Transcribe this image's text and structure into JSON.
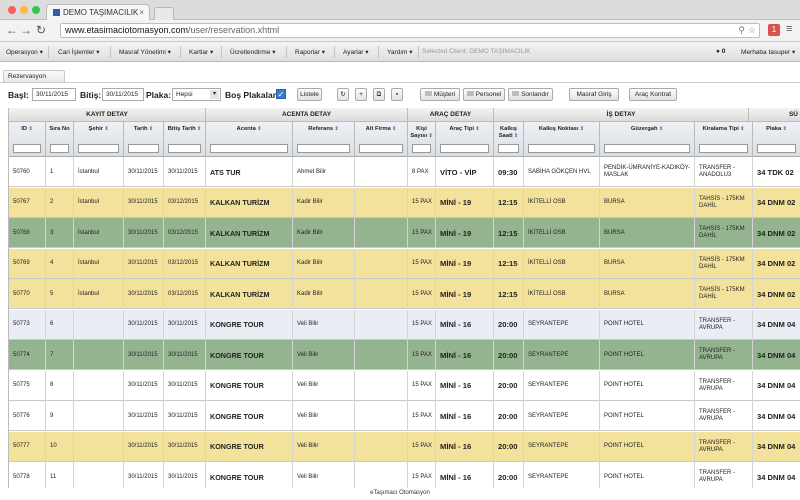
{
  "browser": {
    "tab_title": "DEMO TAŞIMACILIK",
    "url_host": "www.etasimaciotomasyon.com",
    "url_path": "/user/reservation.xhtml",
    "ext_badge": "1"
  },
  "nav": {
    "items": [
      "Operasyon ▾",
      "Cari İşlemler ▾",
      "Masraf Yönetimi ▾",
      "Kartlar ▾",
      "Ücretlendirme ▾",
      "Raporlar ▾",
      "Ayarlar ▾",
      "Yardım ▾"
    ],
    "selected_client": "Selected Client: DEMO TAŞIMACILIK",
    "badge_count": "0",
    "user": "Merhaba tasuper ▾"
  },
  "breadcrumb": "Rezervasyon",
  "filters": {
    "start_label": "Başl:",
    "start_value": "30/11/2015",
    "end_label": "Bitiş:",
    "end_value": "30/11/2015",
    "plate_label": "Plaka:",
    "plate_value": "Hepsi",
    "empty_plates_label": "Boş Plakalar:",
    "list_button": "Listele",
    "customer_button": "Müşteri",
    "staff_button": "Personel",
    "finish_button": "Sonlandır",
    "expense_button": "Masraf Giriş",
    "vehicle_contract_button": "Araç Kontrat"
  },
  "table": {
    "groups": [
      "KAYIT DETAY",
      "ACENTA DETAY",
      "ARAÇ DETAY",
      "İŞ DETAY",
      "SÜ"
    ],
    "headers": {
      "id": "ID",
      "sira": "Sıra No",
      "sehir": "Şehir",
      "tarih": "Tarih",
      "bitis": "Bitiş Tarih",
      "acenta": "Acenta",
      "referans": "Referans",
      "altfirma": "Alt Firma",
      "kisi": "Kişi Sayısı",
      "arac": "Araç Tipi",
      "saat": "Kalkış Saati",
      "kalkis": "Kalkış Noktası",
      "guzergah": "Güzergah",
      "kiralama": "Kiralama Tipi",
      "plaka": "Plaka"
    },
    "rows": [
      {
        "id": "50760",
        "sira": "1",
        "sehir": "İstanbul",
        "tarih": "30/11/2015",
        "bitis": "30/11/2015",
        "acenta": "ATS TUR",
        "referans": "Ahmet Bilir",
        "altfirma": "",
        "kisi": "8 PAX",
        "arac": "VİTO - VİP",
        "saat": "09:30",
        "kalkis": "SABİHA GÖKÇEN HVL",
        "guzergah": "PENDİK-ÜMRANİYE-KADIKÖY-MASLAK",
        "kiralama": "TRANSFER - ANADOLU3",
        "plaka": "34 TDK 02",
        "color": "#ffffff"
      },
      {
        "id": "50767",
        "sira": "2",
        "sehir": "İstanbul",
        "tarih": "30/11/2015",
        "bitis": "03/12/2015",
        "acenta": "KALKAN TURİZM",
        "referans": "Kadir Bilir",
        "altfirma": "",
        "kisi": "15 PAX",
        "arac": "MİNİ - 19",
        "saat": "12:15",
        "kalkis": "İKİTELLİ OSB",
        "guzergah": "BURSA",
        "kiralama": "TAHSİS - 175KM DAHİL",
        "plaka": "34 DNM 02",
        "color": "#f2e29c"
      },
      {
        "id": "50768",
        "sira": "3",
        "sehir": "İstanbul",
        "tarih": "30/11/2015",
        "bitis": "03/12/2015",
        "acenta": "KALKAN TURİZM",
        "referans": "Kadir Bilir",
        "altfirma": "",
        "kisi": "15 PAX",
        "arac": "MİNİ - 19",
        "saat": "12:15",
        "kalkis": "İKİTELLİ OSB",
        "guzergah": "BURSA",
        "kiralama": "TAHSİS - 175KM DAHİL",
        "plaka": "34 DNM 02",
        "color": "#94b48f"
      },
      {
        "id": "50769",
        "sira": "4",
        "sehir": "İstanbul",
        "tarih": "30/11/2015",
        "bitis": "03/12/2015",
        "acenta": "KALKAN TURİZM",
        "referans": "Kadir Bilir",
        "altfirma": "",
        "kisi": "15 PAX",
        "arac": "MİNİ - 19",
        "saat": "12:15",
        "kalkis": "İKİTELLİ OSB",
        "guzergah": "BURSA",
        "kiralama": "TAHSİS - 175KM DAHİL",
        "plaka": "34 DNM 02",
        "color": "#f2e29c"
      },
      {
        "id": "50770",
        "sira": "5",
        "sehir": "İstanbul",
        "tarih": "30/11/2015",
        "bitis": "03/12/2015",
        "acenta": "KALKAN TURİZM",
        "referans": "Kadir Bilir",
        "altfirma": "",
        "kisi": "15 PAX",
        "arac": "MİNİ - 19",
        "saat": "12:15",
        "kalkis": "İKİTELLİ OSB",
        "guzergah": "BURSA",
        "kiralama": "TAHSİS - 175KM DAHİL",
        "plaka": "34 DNM 02",
        "color": "#f2e29c"
      },
      {
        "id": "50773",
        "sira": "6",
        "sehir": "",
        "tarih": "30/11/2015",
        "bitis": "30/11/2015",
        "acenta": "KONGRE TOUR",
        "referans": "Veli Bilir",
        "altfirma": "",
        "kisi": "15 PAX",
        "arac": "MİNİ - 16",
        "saat": "20:00",
        "kalkis": "SEYRANTEPE",
        "guzergah": "POINT HOTEL",
        "kiralama": "TRANSFER - AVRUPA",
        "plaka": "34 DNM 04",
        "color": "#e9eef4"
      },
      {
        "id": "50774",
        "sira": "7",
        "sehir": "",
        "tarih": "30/11/2015",
        "bitis": "30/11/2015",
        "acenta": "KONGRE TOUR",
        "referans": "Veli Bilir",
        "altfirma": "",
        "kisi": "15 PAX",
        "arac": "MİNİ - 16",
        "saat": "20:00",
        "kalkis": "SEYRANTEPE",
        "guzergah": "POINT HOTEL",
        "kiralama": "TRANSFER - AVRUPA",
        "plaka": "34 DNM 04",
        "color": "#94b48f"
      },
      {
        "id": "50775",
        "sira": "8",
        "sehir": "",
        "tarih": "30/11/2015",
        "bitis": "30/11/2015",
        "acenta": "KONGRE TOUR",
        "referans": "Veli Bilir",
        "altfirma": "",
        "kisi": "15 PAX",
        "arac": "MİNİ - 16",
        "saat": "20:00",
        "kalkis": "SEYRANTEPE",
        "guzergah": "POINT HOTEL",
        "kiralama": "TRANSFER - AVRUPA",
        "plaka": "34 DNM 04",
        "color": "#ffffff"
      },
      {
        "id": "50776",
        "sira": "9",
        "sehir": "",
        "tarih": "30/11/2015",
        "bitis": "30/11/2015",
        "acenta": "KONGRE TOUR",
        "referans": "Veli Bilir",
        "altfirma": "",
        "kisi": "15 PAX",
        "arac": "MİNİ - 16",
        "saat": "20:00",
        "kalkis": "SEYRANTEPE",
        "guzergah": "POINT HOTEL",
        "kiralama": "TRANSFER - AVRUPA",
        "plaka": "34 DNM 04",
        "color": "#ffffff"
      },
      {
        "id": "50777",
        "sira": "10",
        "sehir": "",
        "tarih": "30/11/2015",
        "bitis": "30/11/2015",
        "acenta": "KONGRE TOUR",
        "referans": "Veli Bilir",
        "altfirma": "",
        "kisi": "15 PAX",
        "arac": "MİNİ - 16",
        "saat": "20:00",
        "kalkis": "SEYRANTEPE",
        "guzergah": "POINT HOTEL",
        "kiralama": "TRANSFER - AVRUPA",
        "plaka": "34 DNM 04",
        "color": "#f2e29c"
      },
      {
        "id": "50778",
        "sira": "11",
        "sehir": "",
        "tarih": "30/11/2015",
        "bitis": "30/11/2015",
        "acenta": "KONGRE TOUR",
        "referans": "Veli Bilir",
        "altfirma": "",
        "kisi": "15 PAX",
        "arac": "MİNİ - 16",
        "saat": "20:00",
        "kalkis": "SEYRANTEPE",
        "guzergah": "POINT HOTEL",
        "kiralama": "TRANSFER - AVRUPA",
        "plaka": "34 DNM 04",
        "color": "#ffffff"
      }
    ]
  },
  "footer": "eTaşımacı Otomasyon"
}
